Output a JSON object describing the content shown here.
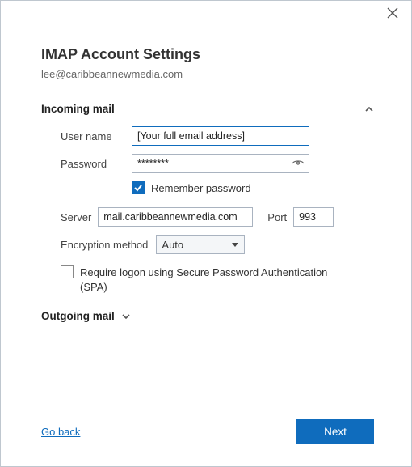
{
  "header": {
    "title": "IMAP Account Settings",
    "email": "lee@caribbeannewmedia.com"
  },
  "incoming": {
    "section_label": "Incoming mail",
    "expanded": true,
    "username_label": "User name",
    "username_value": "[Your full email address]",
    "password_label": "Password",
    "password_value": "********",
    "remember_label": "Remember password",
    "remember_checked": true,
    "server_label": "Server",
    "server_value": "mail.caribbeannewmedia.com",
    "port_label": "Port",
    "port_value": "993",
    "encryption_label": "Encryption method",
    "encryption_value": "Auto",
    "spa_checked": false,
    "spa_label": "Require logon using Secure Password Authentication (SPA)"
  },
  "outgoing": {
    "section_label": "Outgoing mail",
    "expanded": false
  },
  "footer": {
    "go_back": "Go back",
    "next": "Next"
  }
}
